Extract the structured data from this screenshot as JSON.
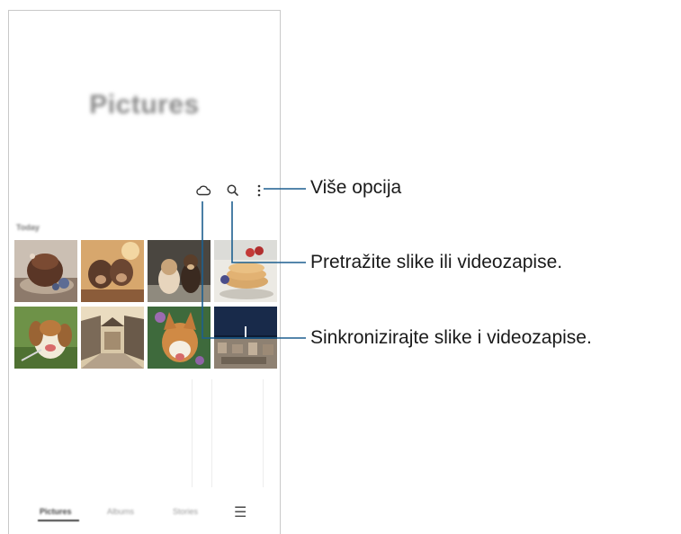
{
  "screen": {
    "title": "Pictures",
    "section_label": "Today"
  },
  "toolbar": {
    "icons": [
      "cloud-sync-icon",
      "search-icon",
      "more-options-icon"
    ]
  },
  "bottom_nav": {
    "items": [
      {
        "label": "Pictures",
        "active": true
      },
      {
        "label": "Albums",
        "active": false
      },
      {
        "label": "Stories",
        "active": false
      }
    ],
    "menu_icon": "☰"
  },
  "callouts": {
    "more_options": "Više opcija",
    "search": "Pretražite slike ili videozapise.",
    "sync": "Sinkronizirajte slike i videozapise."
  },
  "colors": {
    "callout_line": "#1d5f8f",
    "frame": "#c9c9c9"
  }
}
